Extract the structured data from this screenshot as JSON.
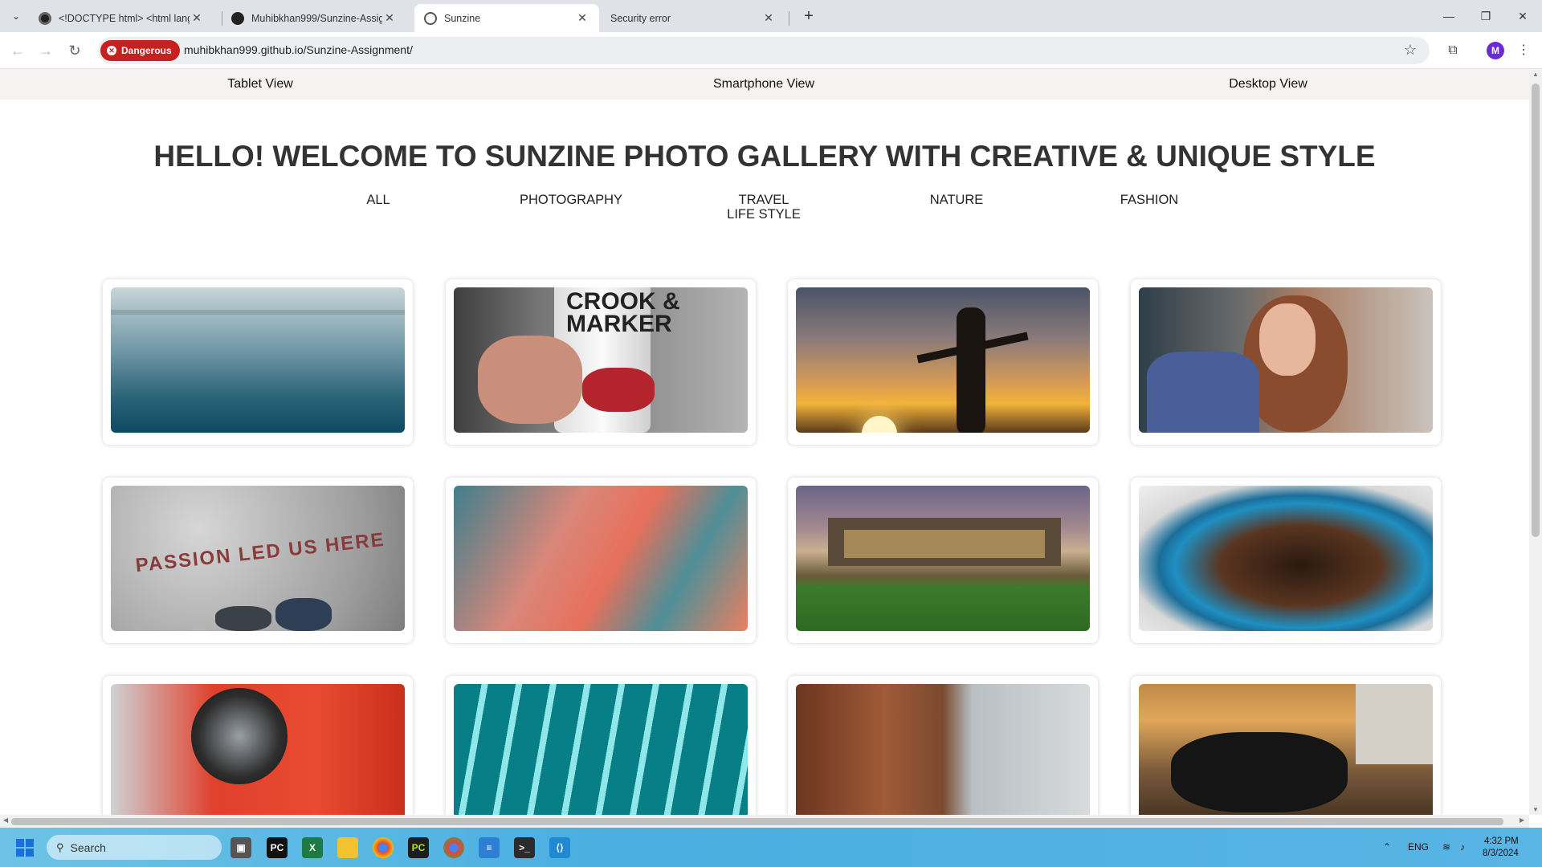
{
  "browser": {
    "tabs": [
      {
        "title": "<!DOCTYPE html> <html lang=",
        "favicon": "circle-dark-icon"
      },
      {
        "title": "Muhibkhan999/Sunzine-Assign",
        "favicon": "github-icon"
      },
      {
        "title": "Sunzine",
        "favicon": "globe-icon"
      },
      {
        "title": "Security error",
        "favicon": ""
      }
    ],
    "close_glyph": "✕",
    "new_tab_glyph": "+",
    "security_badge": "Dangerous",
    "url": "muhibkhan999.github.io/Sunzine-Assignment/",
    "profile_initial": "M"
  },
  "page": {
    "view_nav": [
      "Tablet View",
      "Smartphone View",
      "Desktop View"
    ],
    "heading": "HELLO! WELCOME TO SUNZINE PHOTO GALLERY WITH CREATIVE & UNIQUE STYLE",
    "categories": [
      "ALL",
      "PHOTOGRAPHY",
      "TRAVEL\nLIFE STYLE",
      "NATURE",
      "FASHION"
    ],
    "photos": [
      {
        "subject": "misty lake"
      },
      {
        "subject": "hand holding can",
        "text": "CROOK & MARKER"
      },
      {
        "subject": "man at sunset"
      },
      {
        "subject": "woman portrait"
      },
      {
        "subject": "pavement with shoes",
        "text": "PASSION LED US HERE"
      },
      {
        "subject": "pink clouds"
      },
      {
        "subject": "mansion at dusk"
      },
      {
        "subject": "coffee beans"
      },
      {
        "subject": "red car headlight"
      },
      {
        "subject": "teal stripes"
      },
      {
        "subject": "wooden interior"
      },
      {
        "subject": "motorcycle at sunset"
      }
    ]
  },
  "taskbar": {
    "search_placeholder": "Search",
    "apps": [
      "file-explorer-icon",
      "pycharm-icon",
      "excel-icon",
      "folder-icon",
      "chrome-icon",
      "pycharm-community-icon",
      "chrome-profile-icon",
      "notepad-icon",
      "terminal-icon",
      "vscode-icon"
    ],
    "language": "ENG",
    "time": "4:32 PM",
    "date": "8/3/2024"
  },
  "colors": {
    "danger": "#c5221f",
    "viewnav_bg": "#f7f2f2",
    "heading": "#333333"
  }
}
